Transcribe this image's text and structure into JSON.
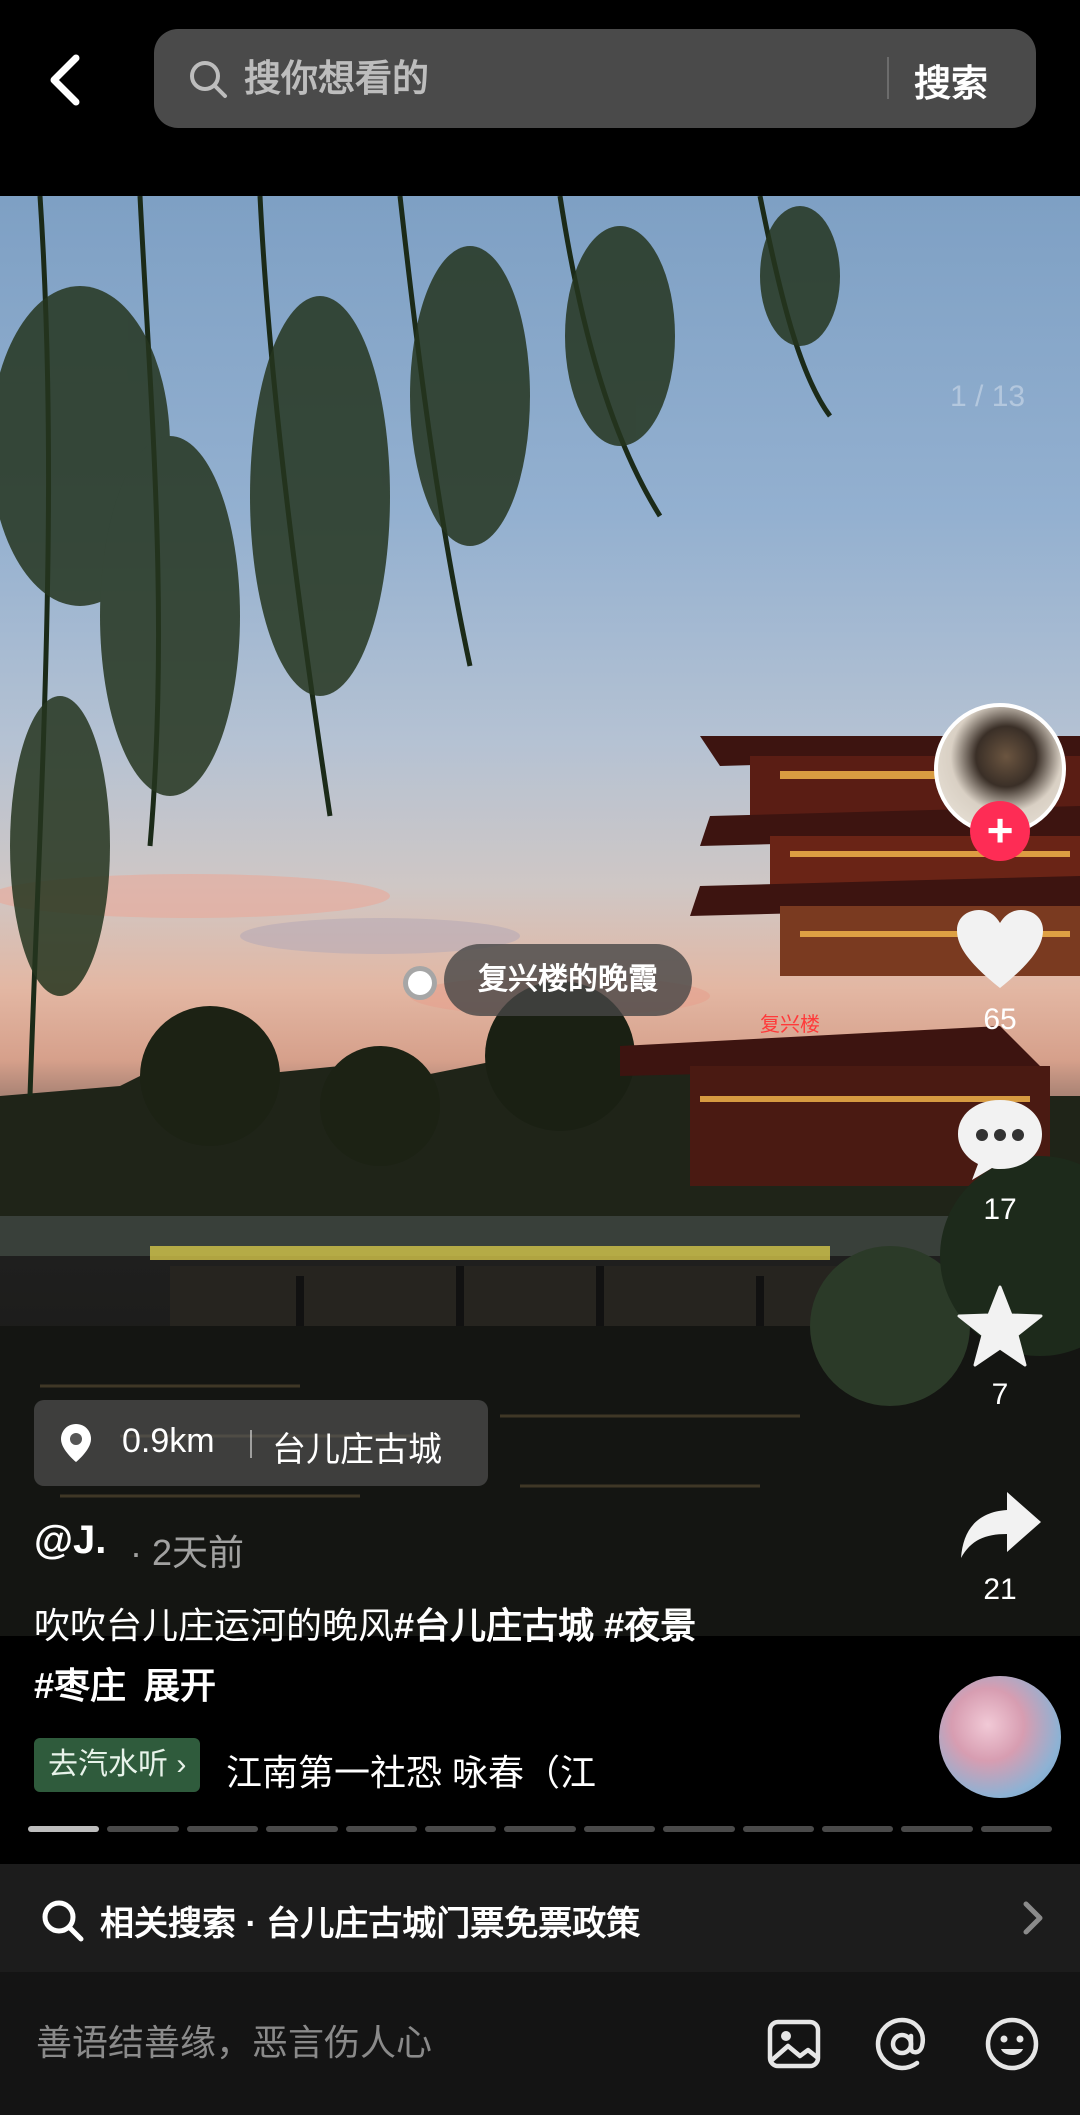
{
  "search": {
    "placeholder": "搜你想看的",
    "button": "搜索"
  },
  "photo": {
    "page_indicator": "1 / 13",
    "tag_label": "复兴楼的晚霞"
  },
  "actions": {
    "likes": "65",
    "comments": "17",
    "favorites": "7",
    "shares": "21"
  },
  "location": {
    "distance": "0.9km",
    "place": "台儿庄古城"
  },
  "post": {
    "author": "@J.",
    "time": "· 2天前",
    "caption_text": "吹吹台儿庄运河的晚风",
    "hashtags": [
      "#台儿庄古城",
      "#夜景",
      "#枣庄"
    ],
    "expand": "展开"
  },
  "music": {
    "button": "去汽水听 ›",
    "text": "江南第一社恐    咏春（江"
  },
  "progress": {
    "total": 13,
    "current": 1
  },
  "related": {
    "label": "相关搜索 · 台儿庄古城门票免票政策"
  },
  "comment": {
    "placeholder": "善语结善缘，恶言伤人心"
  },
  "colors": {
    "follow": "#fe2c55",
    "background": "#000000",
    "music_button": "#2f5b3c"
  },
  "icons": [
    "back-arrow-icon",
    "search-icon",
    "location-pin-icon",
    "heart-icon",
    "comment-icon",
    "star-icon",
    "share-icon",
    "plus-icon",
    "chevron-right-icon",
    "image-icon",
    "at-icon",
    "emoji-icon"
  ]
}
